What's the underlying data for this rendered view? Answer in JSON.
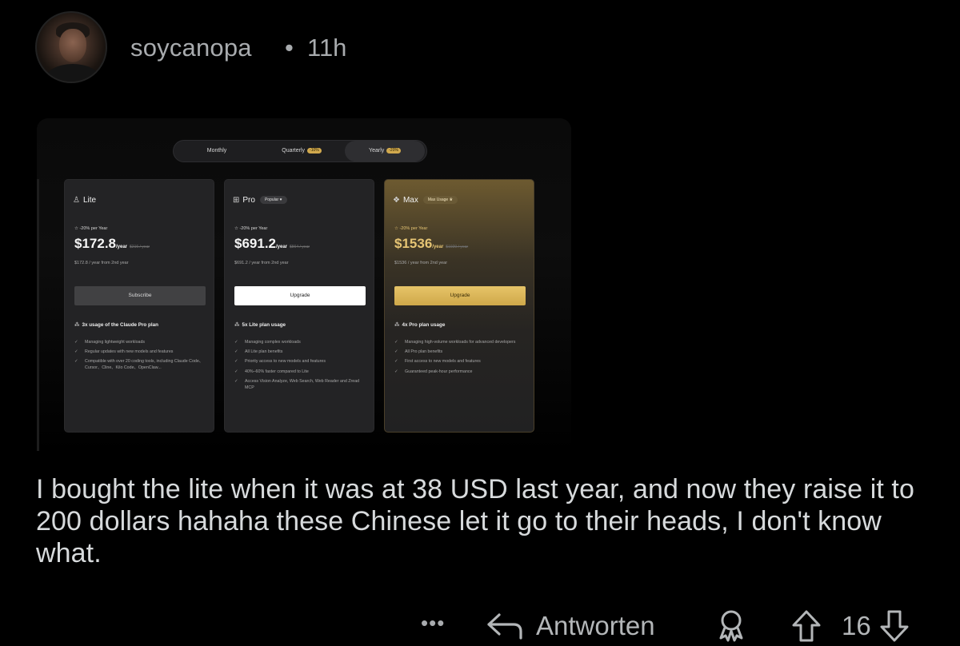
{
  "post": {
    "username": "soycanopa",
    "separator": "•",
    "age": "11h",
    "comment": "I bought the lite when it was at 38 USD last year, and now they raise it to 200 dollars hahaha these Chinese let it go to their heads, I don't know what."
  },
  "pricing": {
    "billing_tabs": [
      {
        "label": "Monthly",
        "discount": ""
      },
      {
        "label": "Quarterly",
        "discount": "-10%"
      },
      {
        "label": "Yearly",
        "discount": "-20%"
      }
    ],
    "active_tab": "Yearly",
    "plans": [
      {
        "name": "Lite",
        "badge": "",
        "discount": "-20% per Year",
        "price": "$172.8",
        "per": "/year",
        "old_price": "$216 / year",
        "sub": "$172.8 / year from 2nd year",
        "button": "Subscribe",
        "feature_title": "3x usage of the Claude Pro plan",
        "features": [
          "Managing lightweight workloads",
          "Regular updates with new models and features",
          "Compatible with over 20 coding tools, including Claude Code、Cursor、Cline、Kilo Code、OpenClaw..."
        ]
      },
      {
        "name": "Pro",
        "badge": "Popular",
        "discount": "-20% per Year",
        "price": "$691.2",
        "per": "/year",
        "old_price": "$864 / year",
        "sub": "$691.2 / year from 2nd year",
        "button": "Upgrade",
        "feature_title": "5x Lite plan usage",
        "features": [
          "Managing complex workloads",
          "All Lite plan benefits",
          "Priority access to new models and features",
          "40%–60% faster compared to Lite",
          "Access Vision Analyze, Web Search, Web Reader and Zread MCP"
        ]
      },
      {
        "name": "Max",
        "badge": "Max Usage",
        "discount": "-20% per Year",
        "price": "$1536",
        "per": "/year",
        "old_price": "$1920 / year",
        "sub": "$1536 / year from 2nd year",
        "button": "Upgrade",
        "feature_title": "4x Pro plan usage",
        "features": [
          "Managing high-volume workloads for advanced developers",
          "All Pro plan benefits",
          "First access to new models and features",
          "Guaranteed peak-hour performance"
        ]
      }
    ]
  },
  "actions": {
    "more": "•••",
    "reply": "Antworten",
    "score": "16"
  },
  "colors": {
    "background": "#000000",
    "text": "#d7dadc",
    "muted": "#a8abae",
    "gold": "#e6c574"
  },
  "icons": {
    "reply": "reply-arrow-icon",
    "award": "award-icon",
    "upvote": "upvote-arrow-icon",
    "downvote": "downvote-arrow-icon"
  }
}
